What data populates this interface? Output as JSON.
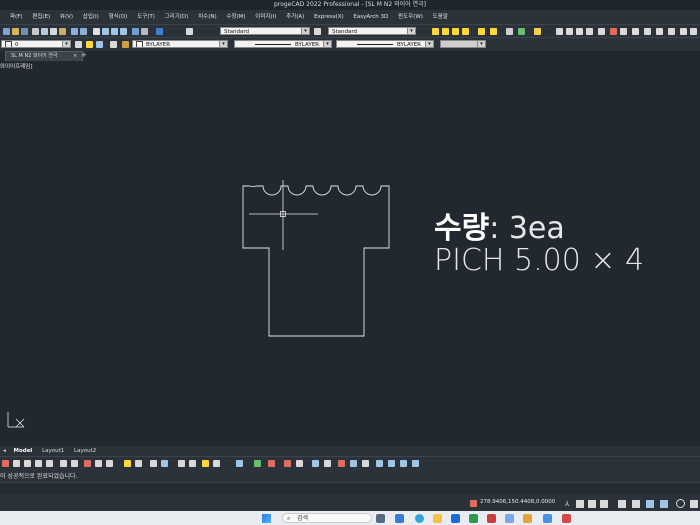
{
  "window": {
    "title": "progeCAD 2022 Professional - [SL M N2 와이어 연극]"
  },
  "menu": [
    "파(F)",
    "편집(E)",
    "뷰(V)",
    "삽입(I)",
    "형식(O)",
    "도구(T)",
    "그리기(D)",
    "치수(N)",
    "수정(M)",
    "이미지(I)",
    "추가(A)",
    "Express(X)",
    "EasyArch 3D",
    "윈도우(W)",
    "도움말"
  ],
  "toolbar": {
    "text_style": "Standard",
    "dim_style": "Standard",
    "layer": "0",
    "color": "BYLAYER",
    "linetype": "BYLAYER",
    "lineweight": "BYLAYER"
  },
  "doc_tab": {
    "label": "SL M N2 와이어 연극",
    "close": "×",
    "add": "+"
  },
  "viewport_label": "와이어프레임]",
  "drawing": {
    "line1_bold": "수량",
    "line1_rest": ": 3ea",
    "line2": "PICH 5.00 × 4"
  },
  "layout_tabs": [
    "Model",
    "Layout1",
    "Layout2"
  ],
  "command_line": {
    "text": "이 성공적으로 완료되었습니다."
  },
  "status": {
    "coords": "278.9406,150.4408,0.0000"
  },
  "taskbar": {
    "search_placeholder": "검색"
  },
  "colors": {
    "canvas": "#212830",
    "panel": "#2b323a",
    "entity": "#e6e6e6",
    "accent_yellow": "#ffd83a"
  }
}
